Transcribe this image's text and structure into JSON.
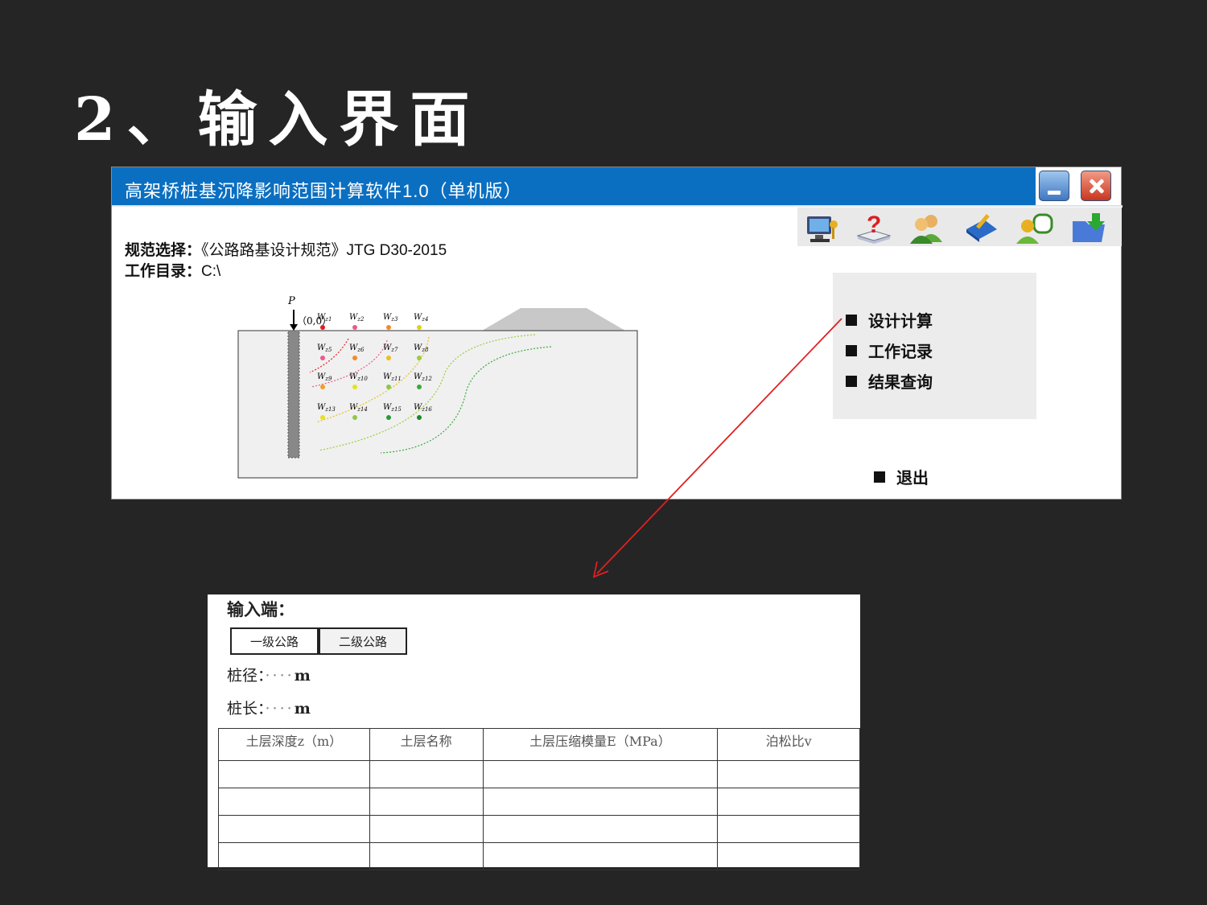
{
  "slide": {
    "title": "2、输入界面"
  },
  "window": {
    "title": "高架桥桩基沉降影响范围计算软件1.0（单机版）",
    "controls": {
      "minimize_icon": "minimize-icon",
      "close_icon": "close-icon"
    },
    "toolbar_icons": [
      "monitor-key-icon",
      "help-book-icon",
      "users-icon",
      "book-edit-icon",
      "user-chat-icon",
      "folder-download-icon"
    ],
    "spec_label": "规范选择：",
    "spec_value": "《公路路基设计规范》JTG D30-2015",
    "dir_label": "工作目录：",
    "dir_value": "C:\\",
    "menu": [
      "设计计算",
      "工作记录",
      "结果查询"
    ],
    "exit_label": "退出",
    "colors": {
      "titlebar": "#0b6fc1",
      "arrow": "#e02020"
    }
  },
  "diagram": {
    "load_label": "P",
    "origin_label": "（0,0）",
    "points": [
      {
        "label": "W",
        "sub": "z1",
        "color": "#e02020"
      },
      {
        "label": "W",
        "sub": "z2",
        "color": "#e85c8c"
      },
      {
        "label": "W",
        "sub": "z3",
        "color": "#f28a2a"
      },
      {
        "label": "W",
        "sub": "z4",
        "color": "#e0d020"
      },
      {
        "label": "W",
        "sub": "z5",
        "color": "#e85c8c"
      },
      {
        "label": "W",
        "sub": "z6",
        "color": "#f28a2a"
      },
      {
        "label": "W",
        "sub": "z7",
        "color": "#e8c020"
      },
      {
        "label": "W",
        "sub": "z8",
        "color": "#9ccc40"
      },
      {
        "label": "W",
        "sub": "z9",
        "color": "#f2a020"
      },
      {
        "label": "W",
        "sub": "z10",
        "color": "#e8e020"
      },
      {
        "label": "W",
        "sub": "z11",
        "color": "#8cc84a"
      },
      {
        "label": "W",
        "sub": "z12",
        "color": "#3aaa3a"
      },
      {
        "label": "W",
        "sub": "z13",
        "color": "#e8e020"
      },
      {
        "label": "W",
        "sub": "z14",
        "color": "#8cc84a"
      },
      {
        "label": "W",
        "sub": "z15",
        "color": "#2a9a3a"
      },
      {
        "label": "W",
        "sub": "z16",
        "color": "#1a8a2a"
      }
    ]
  },
  "input": {
    "title": "输入端：",
    "road_buttons": [
      "一级公路",
      "二级公路"
    ],
    "pile_diameter_label": "桩径：",
    "pile_length_label": "桩长：",
    "placeholder_dots": "····",
    "unit": "m",
    "table": {
      "headers": [
        "土层深度z（m）",
        "土层名称",
        "土层压缩模量E（MPa）",
        "泊松比v"
      ],
      "rows": [
        [
          "",
          "",
          "",
          ""
        ],
        [
          "",
          "",
          "",
          ""
        ],
        [
          "",
          "",
          "",
          ""
        ],
        [
          "",
          "",
          "",
          ""
        ]
      ]
    }
  }
}
